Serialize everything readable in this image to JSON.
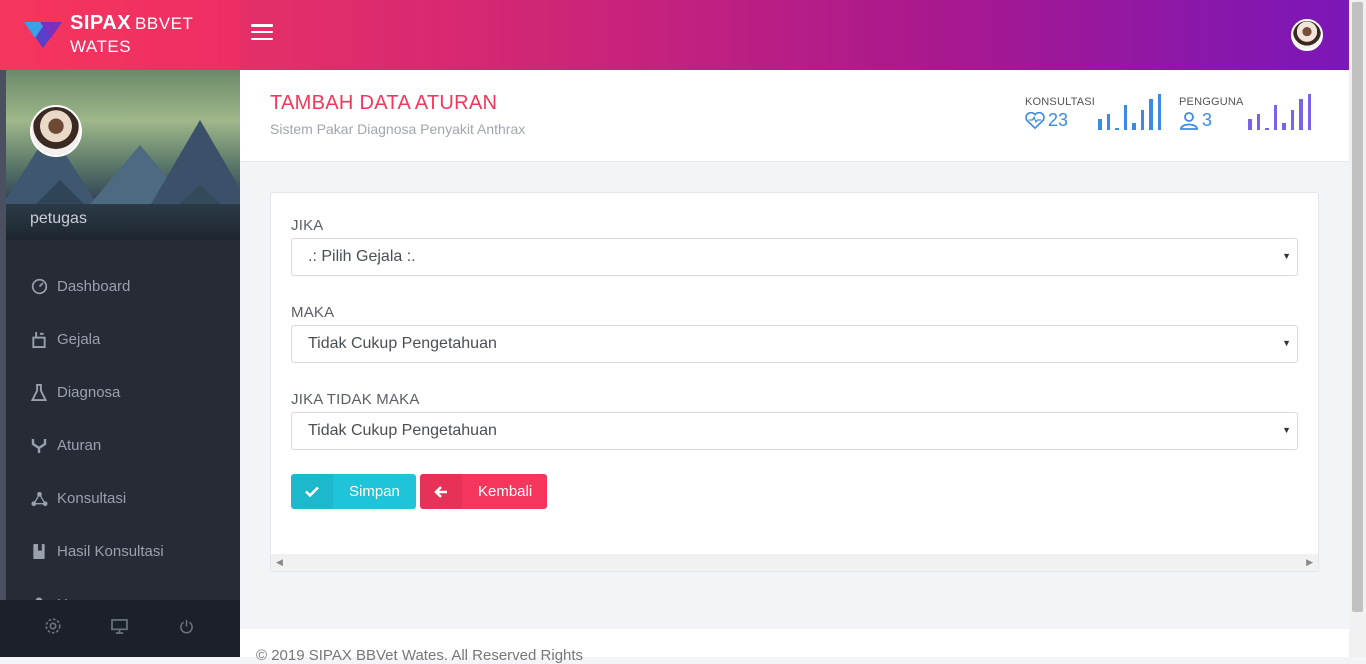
{
  "brand": {
    "name_bold": "SIPAX",
    "name_rest": "BBVET WATES"
  },
  "sidebar": {
    "user_name": "petugas",
    "items": [
      {
        "label": "Dashboard",
        "icon": "dashboard-icon"
      },
      {
        "label": "Gejala",
        "icon": "gejala-icon"
      },
      {
        "label": "Diagnosa",
        "icon": "flask-icon"
      },
      {
        "label": "Aturan",
        "icon": "fork-icon"
      },
      {
        "label": "Konsultasi",
        "icon": "network-icon"
      },
      {
        "label": "Hasil Konsultasi",
        "icon": "book-icon"
      },
      {
        "label": "User",
        "icon": "user-icon"
      }
    ],
    "footer_icons": [
      "settings-icon",
      "monitor-icon",
      "power-icon"
    ]
  },
  "header": {
    "title": "TAMBAH DATA ATURAN",
    "subtitle": "Sistem Pakar Diagnosa Penyakit Anthrax",
    "stats": [
      {
        "label": "KONSULTASI",
        "value": "23",
        "icon": "heart-icon",
        "color": "#3b8ae6",
        "bars": [
          0.3,
          0.45,
          0.05,
          0.7,
          0.2,
          0.55,
          0.85,
          1.0
        ]
      },
      {
        "label": "PENGGUNA",
        "value": "3",
        "icon": "user-outline-icon",
        "color": "#7b63e6",
        "bars": [
          0.3,
          0.45,
          0.05,
          0.7,
          0.2,
          0.55,
          0.85,
          1.0
        ]
      }
    ]
  },
  "form": {
    "jika_label": "JIKA",
    "jika_value": ".: Pilih Gejala :.",
    "maka_label": "MAKA",
    "maka_value": "Tidak Cukup Pengetahuan",
    "jika_tidak_label": "JIKA TIDAK MAKA",
    "jika_tidak_value": "Tidak Cukup Pengetahuan",
    "save_label": "Simpan",
    "back_label": "Kembali"
  },
  "footer": {
    "text": "© 2019 SIPAX BBVet Wates. All Reserved Rights"
  },
  "colors": {
    "accent": "#f5365c",
    "info": "#1fc4d8",
    "sidebar": "#262b36",
    "stat_blue": "#3b8ae6",
    "stat_purple": "#7b63e6"
  }
}
